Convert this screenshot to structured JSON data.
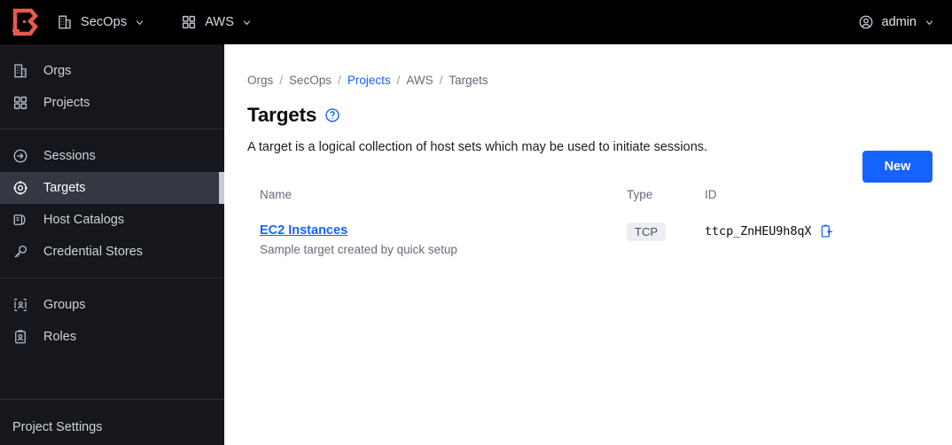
{
  "topbar": {
    "logo_name": "boundary-logo",
    "logo_color": "#e8594f",
    "org": {
      "icon": "building-icon",
      "label": "SecOps",
      "caret": "chevron-down-icon"
    },
    "project": {
      "icon": "grid-icon",
      "label": "AWS",
      "caret": "chevron-down-icon"
    },
    "user": {
      "icon": "user-circle-icon",
      "label": "admin",
      "caret": "chevron-down-icon"
    }
  },
  "sidebar": {
    "groups": [
      {
        "items": [
          {
            "label": "Orgs",
            "icon": "building-icon",
            "active": false
          },
          {
            "label": "Projects",
            "icon": "grid-icon",
            "active": false
          }
        ]
      },
      {
        "items": [
          {
            "label": "Sessions",
            "icon": "sign-in-icon",
            "active": false
          },
          {
            "label": "Targets",
            "icon": "target-icon",
            "active": true
          },
          {
            "label": "Host Catalogs",
            "icon": "server-icon",
            "active": false
          },
          {
            "label": "Credential Stores",
            "icon": "key-icon",
            "active": false
          }
        ]
      },
      {
        "items": [
          {
            "label": "Groups",
            "icon": "users-icon",
            "active": false
          },
          {
            "label": "Roles",
            "icon": "id-card-icon",
            "active": false
          }
        ]
      }
    ],
    "footer": {
      "label": "Project Settings"
    }
  },
  "main": {
    "breadcrumb": [
      {
        "label": "Orgs",
        "link": false
      },
      {
        "label": "SecOps",
        "link": false
      },
      {
        "label": "Projects",
        "link": true
      },
      {
        "label": "AWS",
        "link": false
      },
      {
        "label": "Targets",
        "link": false
      }
    ],
    "breadcrumb_separator": "/",
    "title": "Targets",
    "help_icon": "question-circle-icon",
    "description": "A target is a logical collection of host sets which may be used to initiate sessions.",
    "new_button": "New",
    "accent_color": "#1563ff",
    "table": {
      "columns": [
        "Name",
        "Type",
        "ID"
      ],
      "rows": [
        {
          "name": "EC2 Instances",
          "description": "Sample target created by quick setup",
          "type": "TCP",
          "id": "ttcp_ZnHEU9h8qX",
          "copy_icon": "copy-icon"
        }
      ]
    }
  }
}
